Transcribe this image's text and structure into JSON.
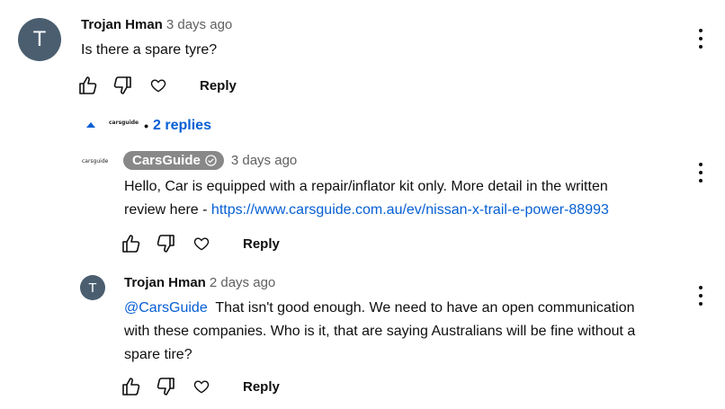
{
  "comment": {
    "avatar_letter": "T",
    "author": "Trojan Hman",
    "time": "3 days ago",
    "text": "Is there a spare tyre?",
    "reply_label": "Reply"
  },
  "replies_toggle": {
    "logo_text": "carsguide",
    "label": "2 replies"
  },
  "reply1": {
    "logo_text": "carsguide",
    "author": "CarsGuide",
    "time": "3 days ago",
    "text_line1": "Hello, Car is equipped with a repair/inflator kit only. More detail in the written",
    "text_line2_prefix": "review here - ",
    "link": "https://www.carsguide.com.au/ev/nissan-x-trail-e-power-88993",
    "reply_label": "Reply"
  },
  "reply2": {
    "avatar_letter": "T",
    "author": "Trojan Hman",
    "time": "2 days ago",
    "mention": "@CarsGuide",
    "text_line1_rest": "  That isn't good enough. We need to have an open communication",
    "text_line2": "with these companies. Who is it, that are saying Australians will be fine without a",
    "text_line3": "spare tire?",
    "reply_label": "Reply"
  },
  "icons": {
    "like": "thumb-up-icon",
    "dislike": "thumb-down-icon",
    "heart": "heart-icon",
    "more": "more-vert-icon",
    "caret": "caret-up-icon",
    "verified": "check-circle-icon"
  },
  "colors": {
    "link": "#065fd4",
    "avatar": "#4a5e70",
    "chip": "#888888"
  }
}
